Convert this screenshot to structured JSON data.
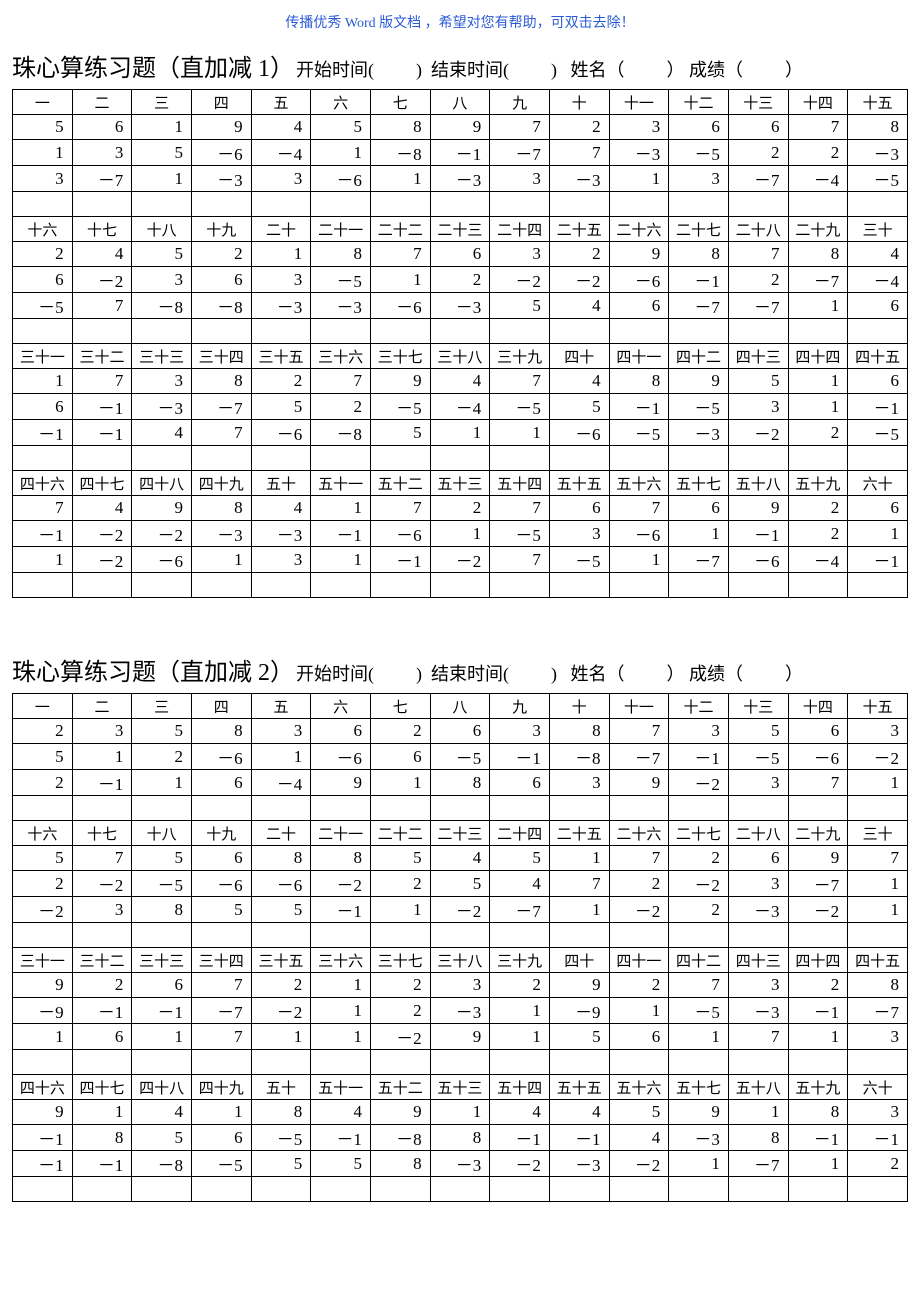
{
  "top_note": "传播优秀 Word 版文档 ，希望对您有帮助，可双击去除！",
  "cn_units": [
    "",
    "一",
    "二",
    "三",
    "四",
    "五",
    "六",
    "七",
    "八",
    "九",
    "十"
  ],
  "meta_labels": {
    "start": "开始时间(",
    "end": "结束时间(",
    "name": "姓名（",
    "score": "成绩（",
    "close_round": "）",
    "close_paren": ")"
  },
  "worksheets": [
    {
      "title_main": "珠心算练习题（直加减 1）",
      "groups": [
        {
          "start": 1,
          "rows": [
            [
              5,
              6,
              1,
              9,
              4,
              5,
              8,
              9,
              7,
              2,
              3,
              6,
              6,
              7,
              8
            ],
            [
              1,
              3,
              5,
              -6,
              -4,
              1,
              -8,
              -1,
              -7,
              7,
              -3,
              -5,
              2,
              2,
              -3
            ],
            [
              3,
              -7,
              1,
              -3,
              3,
              -6,
              1,
              -3,
              3,
              -3,
              1,
              3,
              -7,
              -4,
              -5
            ]
          ]
        },
        {
          "start": 16,
          "rows": [
            [
              2,
              4,
              5,
              2,
              1,
              8,
              7,
              6,
              3,
              2,
              9,
              8,
              7,
              8,
              4
            ],
            [
              6,
              -2,
              3,
              6,
              3,
              -5,
              1,
              2,
              -2,
              -2,
              -6,
              -1,
              2,
              -7,
              -4
            ],
            [
              -5,
              7,
              -8,
              -8,
              -3,
              -3,
              -6,
              -3,
              5,
              4,
              6,
              -7,
              -7,
              1,
              6
            ]
          ]
        },
        {
          "start": 31,
          "rows": [
            [
              1,
              7,
              3,
              8,
              2,
              7,
              9,
              4,
              7,
              4,
              8,
              9,
              5,
              1,
              6
            ],
            [
              6,
              -1,
              -3,
              -7,
              5,
              2,
              -5,
              -4,
              -5,
              5,
              -1,
              -5,
              3,
              1,
              -1
            ],
            [
              -1,
              -1,
              4,
              7,
              -6,
              -8,
              5,
              1,
              1,
              -6,
              -5,
              -3,
              -2,
              2,
              -5
            ]
          ]
        },
        {
          "start": 46,
          "rows": [
            [
              7,
              4,
              9,
              8,
              4,
              1,
              7,
              2,
              7,
              6,
              7,
              6,
              9,
              2,
              6
            ],
            [
              -1,
              -2,
              -2,
              -3,
              -3,
              -1,
              -6,
              1,
              -5,
              3,
              -6,
              1,
              -1,
              2,
              1
            ],
            [
              1,
              -2,
              -6,
              1,
              3,
              1,
              -1,
              -2,
              7,
              -5,
              1,
              -7,
              -6,
              -4,
              -1
            ]
          ]
        }
      ]
    },
    {
      "title_main": "珠心算练习题（直加减 2）",
      "groups": [
        {
          "start": 1,
          "rows": [
            [
              2,
              3,
              5,
              8,
              3,
              6,
              2,
              6,
              3,
              8,
              7,
              3,
              5,
              6,
              3
            ],
            [
              5,
              1,
              2,
              -6,
              1,
              -6,
              6,
              -5,
              -1,
              -8,
              -7,
              -1,
              -5,
              -6,
              -2
            ],
            [
              2,
              -1,
              1,
              6,
              -4,
              9,
              1,
              8,
              6,
              3,
              9,
              -2,
              3,
              7,
              1
            ]
          ]
        },
        {
          "start": 16,
          "rows": [
            [
              5,
              7,
              5,
              6,
              8,
              8,
              5,
              4,
              5,
              1,
              7,
              2,
              6,
              9,
              7
            ],
            [
              2,
              -2,
              -5,
              -6,
              -6,
              -2,
              2,
              5,
              4,
              7,
              2,
              -2,
              3,
              -7,
              1
            ],
            [
              -2,
              3,
              8,
              5,
              5,
              -1,
              1,
              -2,
              -7,
              1,
              -2,
              2,
              -3,
              -2,
              1
            ]
          ]
        },
        {
          "start": 31,
          "rows": [
            [
              9,
              2,
              6,
              7,
              2,
              1,
              2,
              3,
              2,
              9,
              2,
              7,
              3,
              2,
              8
            ],
            [
              -9,
              -1,
              -1,
              -7,
              -2,
              1,
              2,
              -3,
              1,
              -9,
              1,
              -5,
              -3,
              -1,
              -7
            ],
            [
              1,
              6,
              1,
              7,
              1,
              1,
              -2,
              9,
              1,
              5,
              6,
              1,
              7,
              1,
              3
            ]
          ]
        },
        {
          "start": 46,
          "rows": [
            [
              9,
              1,
              4,
              1,
              8,
              4,
              9,
              1,
              4,
              4,
              5,
              9,
              1,
              8,
              3
            ],
            [
              -1,
              8,
              5,
              6,
              -5,
              -1,
              -8,
              8,
              -1,
              -1,
              4,
              -3,
              8,
              -1,
              -1
            ],
            [
              -1,
              -1,
              -8,
              -5,
              5,
              5,
              8,
              -3,
              -2,
              -3,
              -2,
              1,
              -7,
              1,
              2
            ]
          ]
        }
      ]
    }
  ]
}
